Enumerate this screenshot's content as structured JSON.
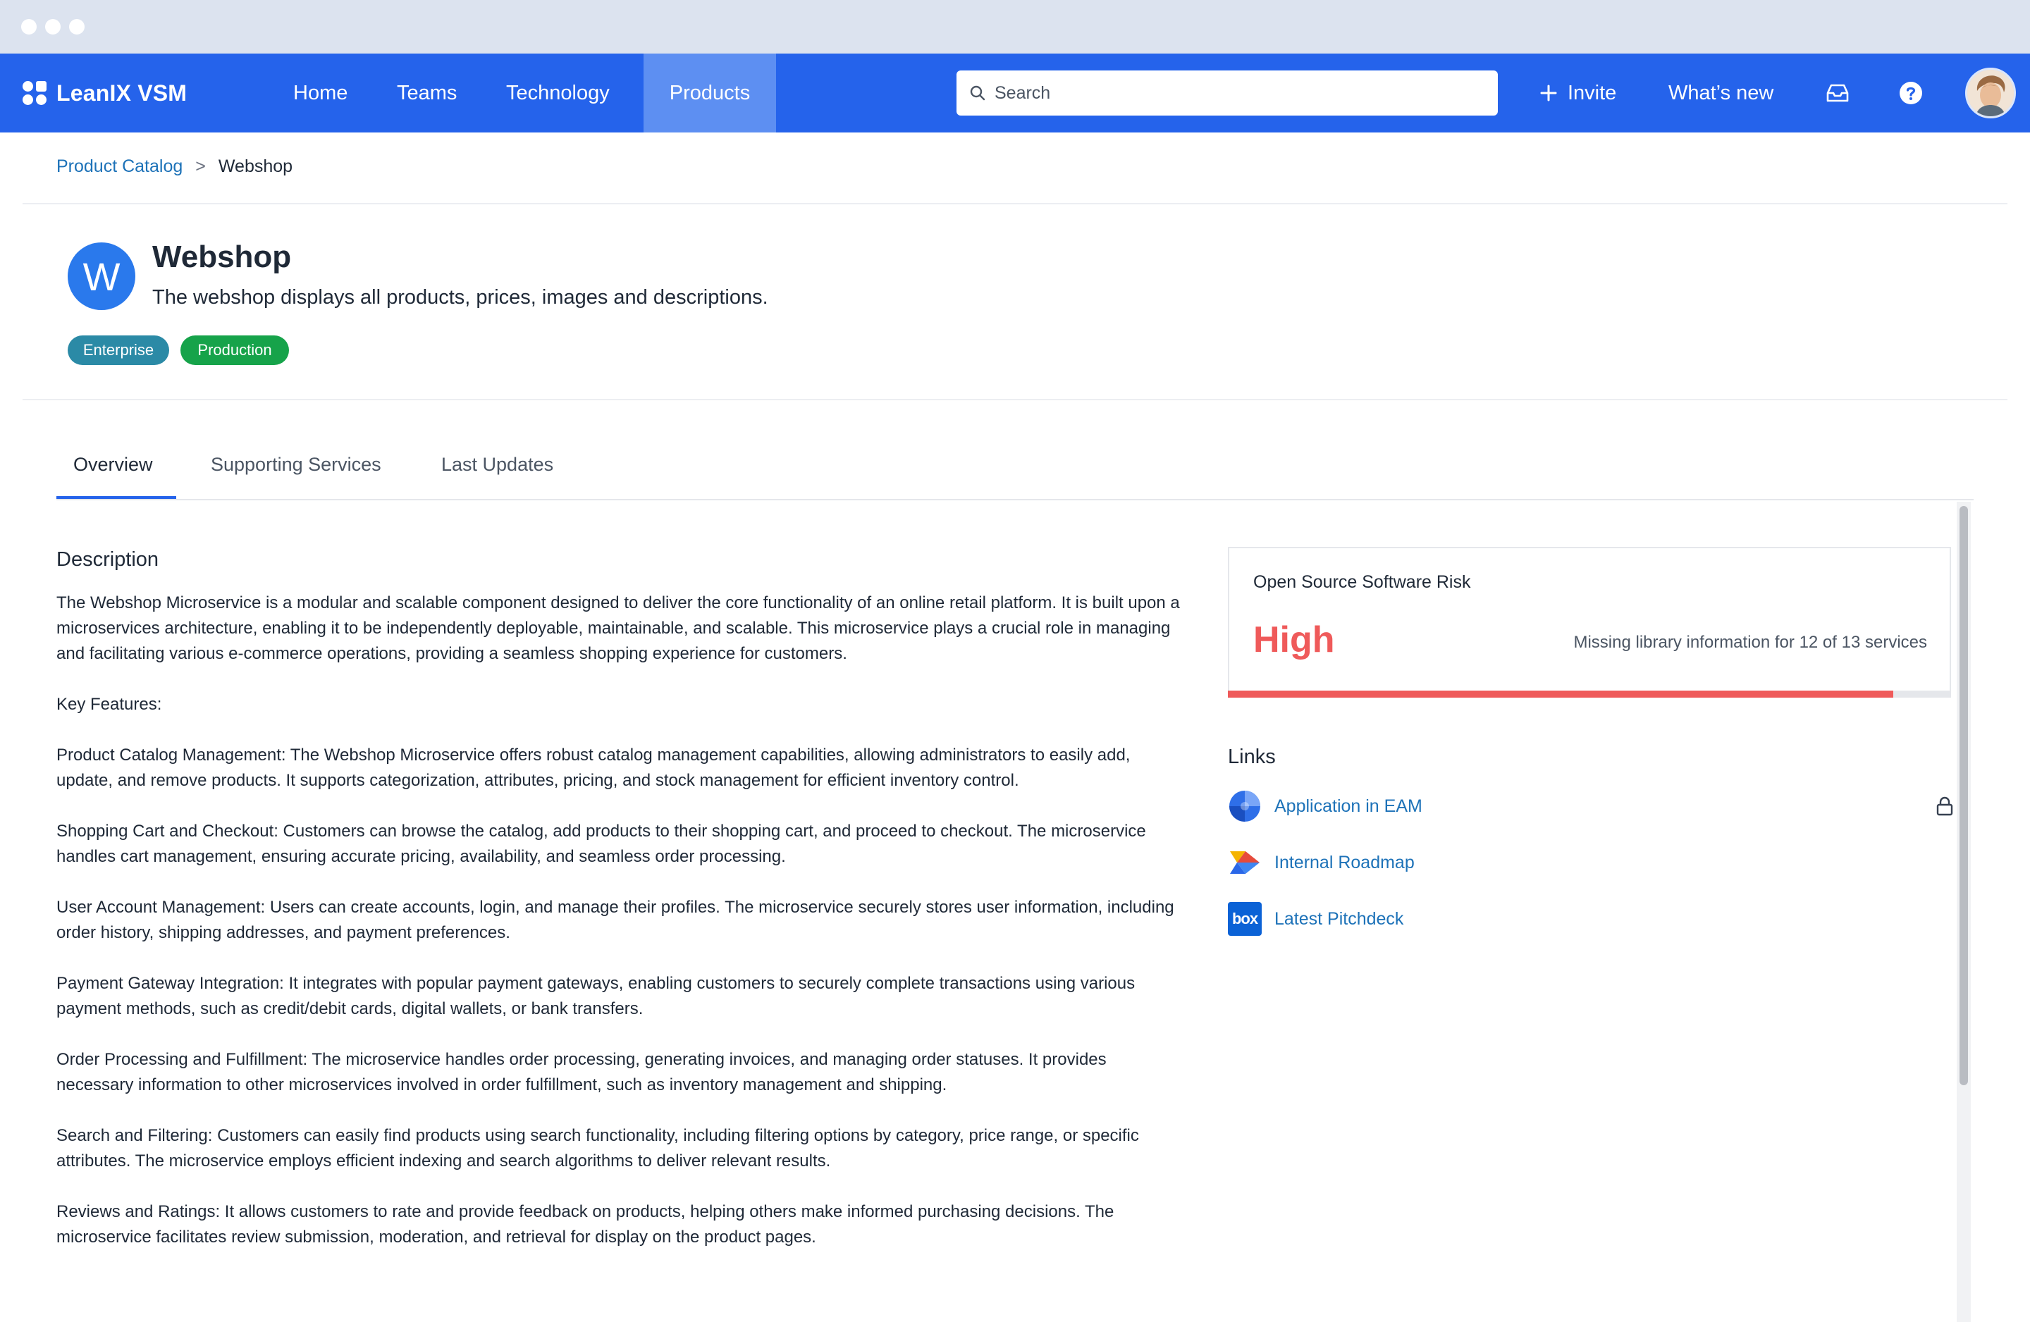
{
  "app": {
    "name": "LeanIX VSM"
  },
  "nav": {
    "items": [
      {
        "label": "Home"
      },
      {
        "label": "Teams"
      },
      {
        "label": "Technology"
      },
      {
        "label": "Products",
        "active": true
      }
    ],
    "search_placeholder": "Search",
    "invite_label": "Invite",
    "whats_new_label": "What’s new",
    "icons": [
      "search-icon",
      "plus-icon",
      "inbox-icon",
      "help-icon"
    ]
  },
  "breadcrumb": {
    "parent": "Product Catalog",
    "separator": ">",
    "current": "Webshop"
  },
  "product": {
    "initial": "W",
    "title": "Webshop",
    "subtitle": "The webshop displays all products, prices, images and descriptions.",
    "tags": [
      {
        "label": "Enterprise",
        "color": "#2b8aa6"
      },
      {
        "label": "Production",
        "color": "#16a34a"
      }
    ]
  },
  "tabs": [
    {
      "label": "Overview",
      "active": true
    },
    {
      "label": "Supporting Services"
    },
    {
      "label": "Last Updates"
    }
  ],
  "description": {
    "title": "Description",
    "paragraphs": [
      "The Webshop Microservice is a modular and scalable component designed to deliver the core functionality of an online retail platform. It is built upon a microservices architecture, enabling it to be independently deployable, maintainable, and scalable. This microservice plays a crucial role in managing and facilitating various e-commerce operations, providing a seamless shopping experience for customers.",
      "Key Features:",
      "Product Catalog Management: The Webshop Microservice offers robust catalog management capabilities, allowing administrators to easily add, update, and remove products. It supports categorization, attributes, pricing, and stock management for efficient inventory control.",
      "Shopping Cart and Checkout: Customers can browse the catalog, add products to their shopping cart, and proceed to checkout. The microservice handles cart management, ensuring accurate pricing, availability, and seamless order processing.",
      "User Account Management: Users can create accounts, login, and manage their profiles. The microservice securely stores user information, including order history, shipping addresses, and payment preferences.",
      "Payment Gateway Integration: It integrates with popular payment gateways, enabling customers to securely complete transactions using various payment methods, such as credit/debit cards, digital wallets, or bank transfers.",
      "Order Processing and Fulfillment: The microservice handles order processing, generating invoices, and managing order statuses. It provides necessary information to other microservices involved in order fulfillment, such as inventory management and shipping.",
      "Search and Filtering: Customers can easily find products using search functionality, including filtering options by category, price range, or specific attributes. The microservice employs efficient indexing and search algorithms to deliver relevant results.",
      "Reviews and Ratings: It allows customers to rate and provide feedback on products, helping others make informed purchasing decisions. The microservice facilitates review submission, moderation, and retrieval for display on the product pages."
    ]
  },
  "risk": {
    "title": "Open Source Software Risk",
    "level": "High",
    "detail": "Missing library information for 12 of 13 services",
    "fill_fraction": 0.92,
    "color": "#ef5a5a"
  },
  "links": {
    "title": "Links",
    "items": [
      {
        "label": "Application in EAM",
        "icon": "leanix-eam-icon",
        "locked": true
      },
      {
        "label": "Internal Roadmap",
        "icon": "roadmap-icon"
      },
      {
        "label": "Latest Pitchdeck",
        "icon": "box-icon",
        "icon_text": "box"
      }
    ]
  }
}
